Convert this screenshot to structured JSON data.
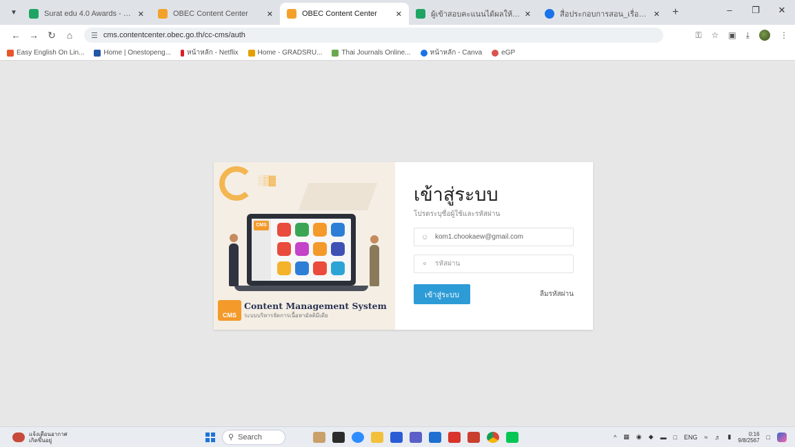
{
  "browser": {
    "tabs": [
      {
        "title": "Surat edu 4.0 Awards - Google",
        "favicon_color": "#1fa463",
        "active": false
      },
      {
        "title": "OBEC Content Center",
        "favicon_color": "#f3a12b",
        "active": false
      },
      {
        "title": "OBEC Content Center",
        "favicon_color": "#f3a12b",
        "active": true
      },
      {
        "title": "ผู้เข้าสอบคะแนนได้ผลให้ได้ - Google",
        "favicon_color": "#1fa463",
        "active": false
      },
      {
        "title": "สื่อประกอบการสอน_เรื่อง_Asking",
        "favicon_color": "#1a73e8",
        "active": false
      }
    ],
    "url": "cms.contentcenter.obec.go.th/cc-cms/auth",
    "bookmarks": [
      {
        "label": "Easy English On Lin...",
        "color": "#e8562a"
      },
      {
        "label": "Home | Onestopeng...",
        "color": "#2456a6"
      },
      {
        "label": "หน้าหลัก - Netflix",
        "color": "#d81f26"
      },
      {
        "label": "Home - GRADSRU...",
        "color": "#e5a000"
      },
      {
        "label": "Thai Journals Online...",
        "color": "#6aa84f"
      },
      {
        "label": "หน้าหลัก - Canva",
        "color": "#1a73e8"
      },
      {
        "label": "eGP",
        "color": "#d9534f"
      }
    ]
  },
  "illustration": {
    "badge": "CMS",
    "brand_title": "Content Management System",
    "brand_subtitle": "ระบบบริหารจัดการเนื้อหามัลติมีเดีย",
    "app_colors": [
      "#e94b3c",
      "#3aa655",
      "#f39a2b",
      "#2d7fd6",
      "#e94b3c",
      "#c443c9",
      "#f39a2b",
      "#3f51b5",
      "#f3b32b",
      "#2d7fd6",
      "#e94b3c",
      "#2da4d6"
    ]
  },
  "login": {
    "title": "เข้าสู่ระบบ",
    "subtitle": "โปรดระบุชื่อผู้ใช้และรหัสผ่าน",
    "username_value": "kom1.chookaew@gmail.com",
    "password_placeholder": "รหัสผ่าน",
    "submit_label": "เข้าสู่ระบบ",
    "forgot_label": "ลืมรหัสผ่าน",
    "accent_color": "#2d9bd6"
  },
  "taskbar": {
    "weather_line1": "แจ้งเตือนอากาศ",
    "weather_line2": "เกิดขึ้นอยู่",
    "search_label": "Search",
    "language": "ENG",
    "time": "0:16",
    "date": "9/8/2567"
  }
}
